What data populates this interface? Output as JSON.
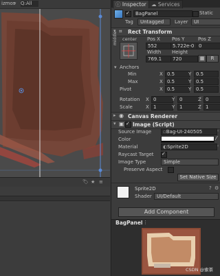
{
  "scene": {
    "toolbar_gizmos": "izmos",
    "toolbar_all": "Q:All"
  },
  "inspector": {
    "tabs": [
      "Inspector",
      "Services"
    ],
    "object": {
      "name": "BagPanel",
      "static_label": "Static",
      "tag_label": "Tag",
      "tag_value": "Untagged",
      "layer_label": "Layer",
      "layer_value": "UI"
    },
    "rect_transform": {
      "title": "Rect Transform",
      "anchor_preset_top": "center",
      "anchor_preset_side": "middle",
      "pos_x_label": "Pos X",
      "pos_y_label": "Pos Y",
      "pos_z_label": "Pos Z",
      "pos_x": "552",
      "pos_y": "5.722e-0",
      "pos_z": "0",
      "width_label": "Width",
      "height_label": "Height",
      "width": "769.1",
      "height": "720",
      "anchors_label": "Anchors",
      "min_label": "Min",
      "max_label": "Max",
      "min_x": "0.5",
      "min_y": "0.5",
      "max_x": "0.5",
      "max_y": "0.5",
      "pivot_label": "Pivot",
      "pivot_x": "0.5",
      "pivot_y": "0.5",
      "rotation_label": "Rotation",
      "rot_x": "0",
      "rot_y": "0",
      "rot_z": "0",
      "scale_label": "Scale",
      "scale_x": "1",
      "scale_y": "1",
      "scale_z": "1",
      "x": "X",
      "y": "Y",
      "z": "Z",
      "r_button": "R"
    },
    "canvas_renderer": {
      "title": "Canvas Renderer"
    },
    "image": {
      "title": "Image (Script)",
      "source_image_label": "Source Image",
      "source_image_value": "Bag-UI-240505",
      "color_label": "Color",
      "material_label": "Material",
      "material_value": "Sprite2D",
      "raycast_label": "Raycast Target",
      "image_type_label": "Image Type",
      "image_type_value": "Simple",
      "preserve_label": "Preserve Aspect",
      "set_native_size": "Set Native Size"
    },
    "material_block": {
      "name": "Sprite2D",
      "shader_label": "Shader",
      "shader_value": "UI/Default"
    },
    "add_component": "Add Component",
    "preview": {
      "title": "BagPanel",
      "watermark": "CSDN @索茶"
    }
  },
  "colors": {
    "editor_bg": "#383838",
    "panel_bg": "#3c3c3c",
    "selection_blue": "#5a8ad6",
    "bag_brown": "#8a4a35",
    "bag_cream": "#e8cfae"
  }
}
